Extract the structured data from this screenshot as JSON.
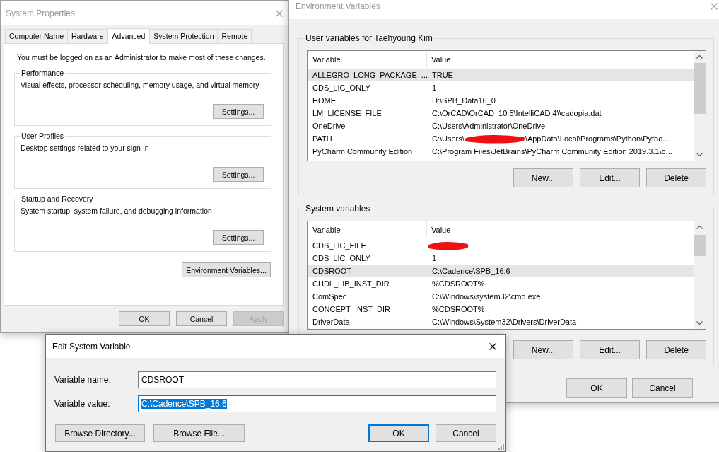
{
  "system_properties": {
    "window": {
      "title": "System Properties",
      "active": false
    },
    "tabs": [
      {
        "label": "Computer Name",
        "selected": false
      },
      {
        "label": "Hardware",
        "selected": false
      },
      {
        "label": "Advanced",
        "selected": true
      },
      {
        "label": "System Protection",
        "selected": false
      },
      {
        "label": "Remote",
        "selected": false
      }
    ],
    "notice": "You must be logged on as an Administrator to make most of these changes.",
    "groups": [
      {
        "title": "Performance",
        "description": "Visual effects, processor scheduling, memory usage, and virtual memory",
        "button": "Settings..."
      },
      {
        "title": "User Profiles",
        "description": "Desktop settings related to your sign-in",
        "button": "Settings..."
      },
      {
        "title": "Startup and Recovery",
        "description": "System startup, system failure, and debugging information",
        "button": "Settings..."
      }
    ],
    "environment_button": "Environment Variables...",
    "buttons": [
      {
        "label": "OK",
        "disabled": false
      },
      {
        "label": "Cancel",
        "disabled": false
      },
      {
        "label": "Apply",
        "disabled": true
      }
    ]
  },
  "environment_variables": {
    "window": {
      "title": "Environment Variables",
      "active": false
    },
    "user_variables": {
      "title": "User variables for Taehyoung Kim",
      "columns": [
        "Variable",
        "Value"
      ],
      "rows": [
        {
          "variable": "ALLEGRO_LONG_PACKAGE_...",
          "value": "TRUE",
          "redacted": false,
          "selected": true
        },
        {
          "variable": "CDS_LIC_ONLY",
          "value": "1",
          "redacted": false,
          "selected": false
        },
        {
          "variable": "HOME",
          "value": "D:\\SPB_Data16_0",
          "redacted": false,
          "selected": false
        },
        {
          "variable": "LM_LICENSE_FILE",
          "value": "C:\\OrCAD\\OrCAD_10.5\\IntelliCAD 4\\\\cadopia.dat",
          "redacted": false,
          "selected": false
        },
        {
          "variable": "OneDrive",
          "value": "C:\\Users\\Administrator\\OneDrive",
          "redacted": false,
          "selected": false
        },
        {
          "variable": "PATH",
          "value": "C:\\Users\\",
          "redacted": true,
          "value_after": "\\AppData\\Local\\Programs\\Python\\Pytho...",
          "selected": false
        },
        {
          "variable": "PyCharm Community Edition",
          "value": "C:\\Program Files\\JetBrains\\PyCharm Community Edition 2019.3.1\\b...",
          "redacted": false,
          "selected": false
        }
      ],
      "buttons": [
        "New...",
        "Edit...",
        "Delete"
      ]
    },
    "system_variables": {
      "title": "System variables",
      "columns": [
        "Variable",
        "Value"
      ],
      "rows": [
        {
          "variable": "CDS_LIC_FILE",
          "redacted": true,
          "selected": false
        },
        {
          "variable": "CDS_LIC_ONLY",
          "value": "1",
          "redacted": false,
          "selected": false
        },
        {
          "variable": "CDSROOT",
          "value": "C:\\Cadence\\SPB_16.6",
          "redacted": false,
          "selected": true
        },
        {
          "variable": "CHDL_LIB_INST_DIR",
          "value": "%CDSROOT%",
          "redacted": false,
          "selected": false
        },
        {
          "variable": "ComSpec",
          "value": "C:\\Windows\\system32\\cmd.exe",
          "redacted": false,
          "selected": false
        },
        {
          "variable": "CONCEPT_INST_DIR",
          "value": "%CDSROOT%",
          "redacted": false,
          "selected": false
        },
        {
          "variable": "DriverData",
          "value": "C:\\Windows\\System32\\Drivers\\DriverData",
          "redacted": false,
          "selected": false
        }
      ],
      "buttons": [
        "New...",
        "Edit...",
        "Delete"
      ]
    },
    "buttons": [
      "OK",
      "Cancel"
    ]
  },
  "edit_dialog": {
    "window": {
      "title": "Edit System Variable",
      "active": true
    },
    "fields": [
      {
        "label": "Variable name:",
        "value": "CDSROOT",
        "focused": false
      },
      {
        "label": "Variable value:",
        "value": "C:\\Cadence\\SPB_16.6",
        "focused": true
      }
    ],
    "browse_buttons": [
      "Browse Directory...",
      "Browse File..."
    ],
    "buttons": [
      {
        "label": "OK",
        "default": true
      },
      {
        "label": "Cancel",
        "default": false
      }
    ]
  }
}
